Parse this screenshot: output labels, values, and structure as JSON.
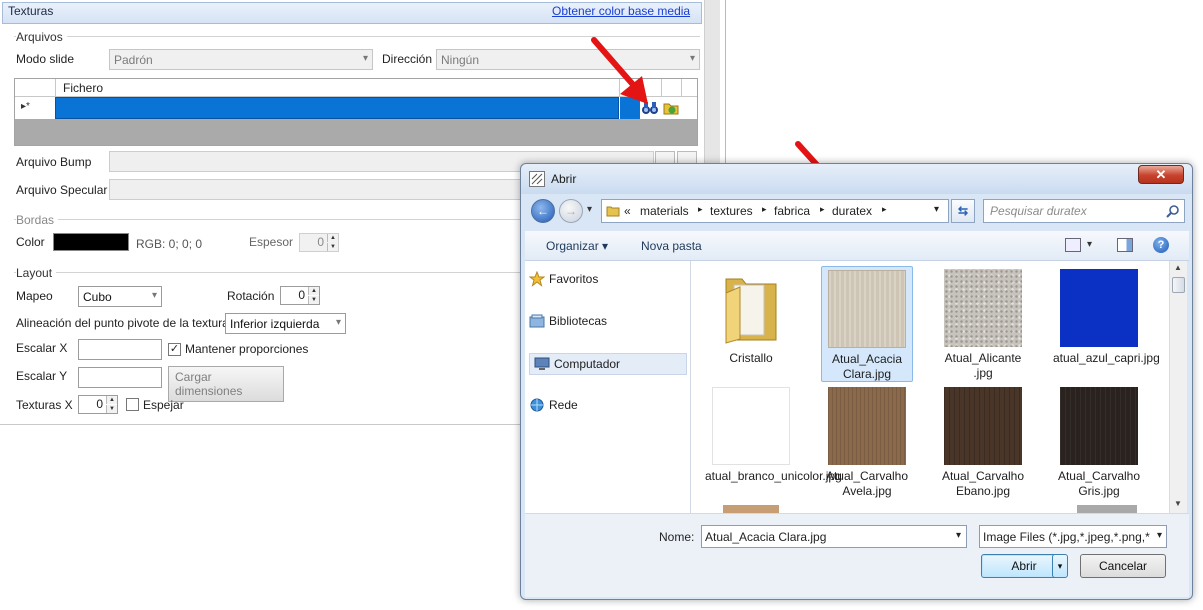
{
  "panel": {
    "title": "Texturas",
    "link": "Obtener color base media",
    "groups": {
      "arquivos": "Arquivos",
      "bordas": "Bordas",
      "layout": "Layout"
    },
    "modo_slide": {
      "label": "Modo slide",
      "value": "Padrón"
    },
    "direccion": {
      "label": "Dirección",
      "value": "Ningún"
    },
    "grid": {
      "header": "Fichero",
      "row_marker": "▸*"
    },
    "bump_label": "Arquivo Bump",
    "specular_label": "Arquivo Specular",
    "color": {
      "label": "Color",
      "swatch": "#000000",
      "rgb": "RGB: 0; 0; 0"
    },
    "espesor": {
      "label": "Espesor",
      "value": "0"
    },
    "mapeo": {
      "label": "Mapeo",
      "value": "Cubo"
    },
    "rotacion": {
      "label": "Rotación",
      "value": "0"
    },
    "pivote": {
      "label": "Alineación del punto pivote de la textura",
      "value": "Inferior izquierda"
    },
    "escalar_x": {
      "label": "Escalar X",
      "value": ""
    },
    "mantener": {
      "label": "Mantener proporciones",
      "checked": "✓"
    },
    "escalar_y": {
      "label": "Escalar Y",
      "value": ""
    },
    "cargar": "Cargar dimensiones",
    "texturas_x": {
      "label": "Texturas X",
      "value": "0"
    },
    "espejar": {
      "label": "Espejar"
    }
  },
  "dialog": {
    "title": "Abrir",
    "close": "✕",
    "breadcrumb": [
      "«",
      "materials",
      "textures",
      "fabrica",
      "duratex"
    ],
    "search_placeholder": "Pesquisar duratex",
    "toolbar": {
      "organize": "Organizar ▾",
      "new_folder": "Nova pasta"
    },
    "nav": [
      "Favoritos",
      "Bibliotecas",
      "Computador",
      "Rede"
    ],
    "files": [
      {
        "name": "Cristallo",
        "color": "#e8c860"
      },
      {
        "name": "Atual_Acacia Clara.jpg",
        "color": "#d4cbbb"
      },
      {
        "name": "Atual_Alicante .jpg",
        "color": "#c7c3bd"
      },
      {
        "name": "atual_azul_capri.jpg",
        "color": "#0b31c4"
      },
      {
        "name": "atual_branco_unicolor.jpg",
        "color": "#ffffff"
      },
      {
        "name": "Atual_Carvalho Avela.jpg",
        "color": "#8b6a4c"
      },
      {
        "name": "Atual_Carvalho Ebano.jpg",
        "color": "#4a3628"
      },
      {
        "name": "Atual_Carvalho Gris.jpg",
        "color": "#2a221f"
      }
    ],
    "filename_label": "Nome:",
    "filename_value": "Atual_Acacia Clara.jpg",
    "filter": "Image Files (*.jpg,*.jpeg,*.png,*",
    "open": "Abrir",
    "cancel": "Cancelar"
  }
}
